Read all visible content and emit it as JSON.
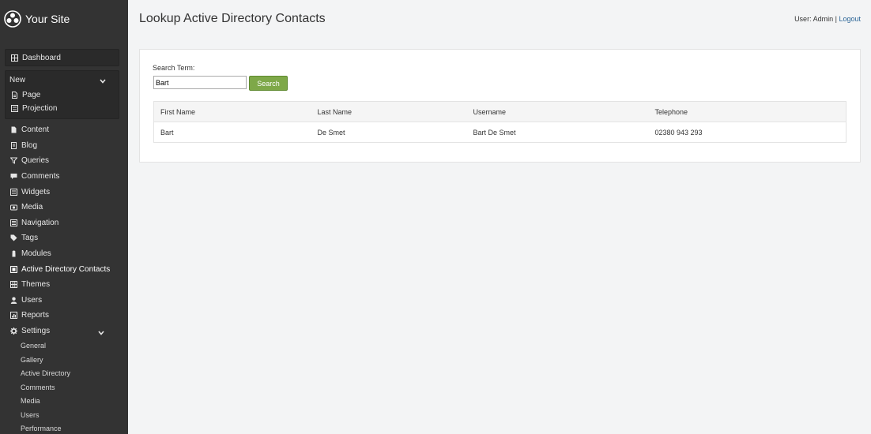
{
  "brand": {
    "name": "Your Site",
    "logo_icon": "flower-logo-icon"
  },
  "sidebar": {
    "dashboard": {
      "label": "Dashboard",
      "icon": "grid-icon"
    },
    "new_section": {
      "label": "New",
      "items": [
        {
          "label": "Page",
          "icon": "file-icon"
        },
        {
          "label": "Projection",
          "icon": "list-icon"
        }
      ]
    },
    "items": [
      {
        "label": "Content",
        "icon": "file-icon"
      },
      {
        "label": "Blog",
        "icon": "book-icon"
      },
      {
        "label": "Queries",
        "icon": "filter-icon"
      },
      {
        "label": "Comments",
        "icon": "comment-icon"
      },
      {
        "label": "Widgets",
        "icon": "list-icon"
      },
      {
        "label": "Media",
        "icon": "camera-icon"
      },
      {
        "label": "Navigation",
        "icon": "list-icon"
      },
      {
        "label": "Tags",
        "icon": "tag-icon"
      },
      {
        "label": "Modules",
        "icon": "puzzle-icon"
      },
      {
        "label": "Active Directory Contacts",
        "icon": "square-icon"
      },
      {
        "label": "Themes",
        "icon": "grid-icon"
      },
      {
        "label": "Users",
        "icon": "user-icon"
      },
      {
        "label": "Reports",
        "icon": "report-icon"
      }
    ],
    "settings": {
      "label": "Settings",
      "icon": "gear-icon",
      "items": [
        "General",
        "Gallery",
        "Active Directory",
        "Comments",
        "Media",
        "Users",
        "Performance"
      ]
    }
  },
  "header": {
    "title": "Lookup Active Directory Contacts",
    "user_text": "User: Admin",
    "separator": "|",
    "logout_label": "Logout"
  },
  "search": {
    "label": "Search Term:",
    "value": "Bart",
    "button_label": "Search"
  },
  "table": {
    "columns": [
      "First Name",
      "Last Name",
      "Username",
      "Telephone"
    ],
    "rows": [
      [
        "Bart",
        "De Smet",
        "Bart De Smet",
        "02380 943 293"
      ]
    ]
  },
  "colors": {
    "sidebar_bg": "#333333",
    "accent_green": "#7ea848",
    "link": "#2a6496"
  }
}
